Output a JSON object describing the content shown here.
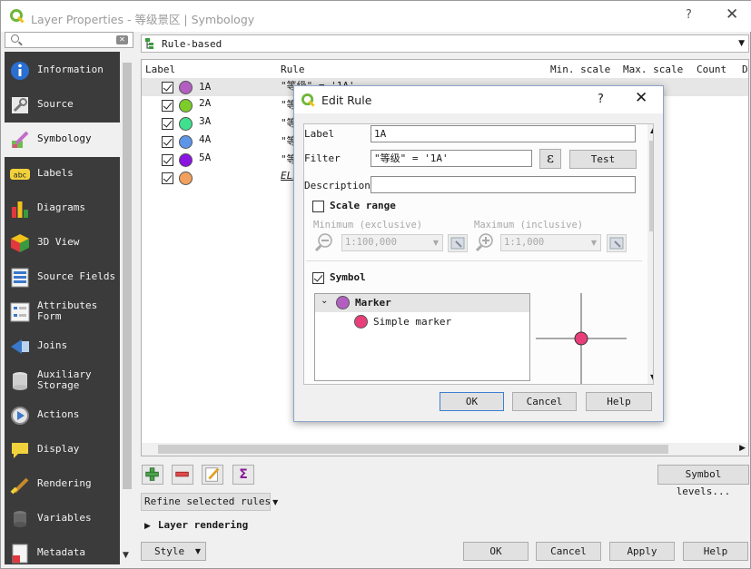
{
  "window": {
    "title": "Layer Properties - 等级景区 | Symbology",
    "help_glyph": "?",
    "close_glyph": "✕"
  },
  "search": {
    "placeholder": "",
    "clear_glyph": "✕"
  },
  "sidebar": {
    "items": [
      {
        "label": "Information",
        "icon": "info-icon",
        "active": false
      },
      {
        "label": "Source",
        "icon": "wrench-icon",
        "active": false
      },
      {
        "label": "Symbology",
        "icon": "paintbrush-icon",
        "active": true
      },
      {
        "label": "Labels",
        "icon": "abc-label-icon",
        "active": false
      },
      {
        "label": "Diagrams",
        "icon": "diagram-icon",
        "active": false
      },
      {
        "label": "3D View",
        "icon": "cube-icon",
        "active": false
      },
      {
        "label": "Source Fields",
        "icon": "fields-icon",
        "active": false
      },
      {
        "label": "Attributes\nForm",
        "icon": "form-icon",
        "active": false
      },
      {
        "label": "Joins",
        "icon": "joins-icon",
        "active": false
      },
      {
        "label": "Auxiliary\nStorage",
        "icon": "database-icon",
        "active": false
      },
      {
        "label": "Actions",
        "icon": "actions-icon",
        "active": false
      },
      {
        "label": "Display",
        "icon": "speech-bubble-icon",
        "active": false
      },
      {
        "label": "Rendering",
        "icon": "brush-icon",
        "active": false
      },
      {
        "label": "Variables",
        "icon": "variables-icon",
        "active": false
      },
      {
        "label": "Metadata",
        "icon": "metadata-icon",
        "active": false
      }
    ]
  },
  "renderer": {
    "selected": "Rule-based",
    "arrow": "▼"
  },
  "rules_table": {
    "headers": [
      "Label",
      "Rule",
      "Min. scale",
      "Max. scale",
      "Count",
      "Du"
    ],
    "rows": [
      {
        "label": "1A",
        "rule": "\"等级\" = '1A'",
        "color": "#b35fc2",
        "checked": true,
        "selected": true
      },
      {
        "label": "2A",
        "rule": "\"等",
        "color": "#7ccd2a",
        "checked": true,
        "selected": false
      },
      {
        "label": "3A",
        "rule": "\"等",
        "color": "#3fe08e",
        "checked": true,
        "selected": false
      },
      {
        "label": "4A",
        "rule": "\"等",
        "color": "#5d95e8",
        "checked": true,
        "selected": false
      },
      {
        "label": "5A",
        "rule": "\"等",
        "color": "#8a14e0",
        "checked": true,
        "selected": false
      },
      {
        "label": "",
        "rule": "ELS",
        "color": "#f2a05e",
        "checked": true,
        "selected": false
      }
    ]
  },
  "toolbar": {
    "add_icon": "add-rule-icon",
    "remove_icon": "remove-rule-icon",
    "edit_icon": "edit-rule-icon",
    "sigma_glyph": "Σ",
    "symbol_levels_label": "Symbol levels...",
    "refine_label": "Refine selected rules",
    "refine_arrow": "▼",
    "layer_rendering_label": "Layer rendering",
    "layer_rendering_arrow": "▶"
  },
  "footer": {
    "style_label": "Style",
    "style_arrow": "▼",
    "ok_label": "OK",
    "cancel_label": "Cancel",
    "apply_label": "Apply",
    "help_label": "Help"
  },
  "edit_rule": {
    "title": "Edit Rule",
    "help_glyph": "?",
    "close_glyph": "✕",
    "label_caption": "Label",
    "label_value": "1A",
    "filter_caption": "Filter",
    "filter_value": "\"等级\" = '1A'",
    "expression_glyph": "ε",
    "test_label": "Test",
    "description_caption": "Description",
    "description_value": "",
    "scale_range_label": "Scale range",
    "scale_range_checked": false,
    "minimum_caption": "Minimum (exclusive)",
    "maximum_caption": "Maximum (inclusive)",
    "minimum_value": "1:100,000",
    "maximum_value": "1:1,000",
    "symbol_label": "Symbol",
    "symbol_checked": true,
    "symbol_tree": {
      "root_label": "Marker",
      "root_color": "#b35fc2",
      "child_label": "Simple marker",
      "child_color": "#e83f7a"
    },
    "preview_color": "#e83f7a",
    "ok_label": "OK",
    "cancel_label": "Cancel",
    "help_label": "Help"
  }
}
